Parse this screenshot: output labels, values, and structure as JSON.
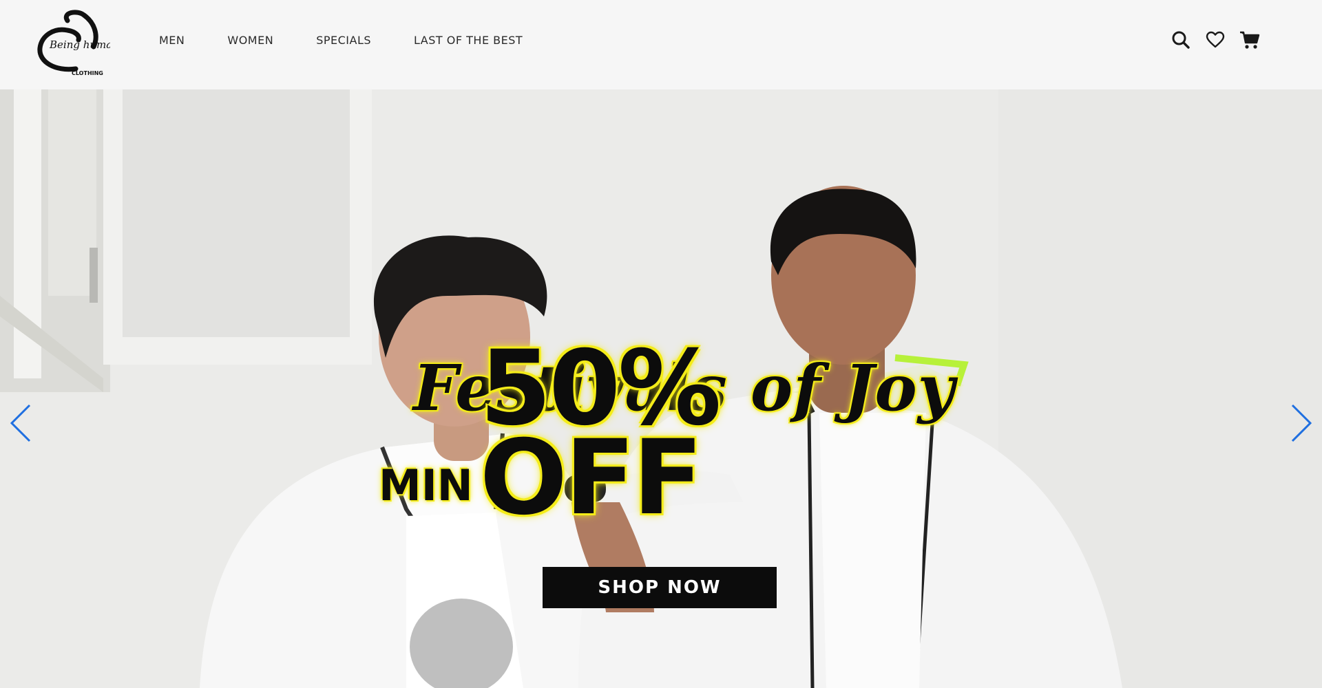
{
  "brand": {
    "name": "Being human",
    "sub": "CLOTHING"
  },
  "nav": {
    "items": [
      {
        "label": "MEN"
      },
      {
        "label": "WOMEN"
      },
      {
        "label": "SPECIALS"
      },
      {
        "label": "LAST OF THE BEST"
      }
    ]
  },
  "header_icons": [
    "search-icon",
    "heart-icon",
    "cart-icon"
  ],
  "hero": {
    "title": "Festivals of Joy",
    "offer_prefix": "MIN",
    "offer_main": "50% OFF",
    "cta": "SHOP NOW",
    "arrows": [
      "chevron-left-icon",
      "chevron-right-icon"
    ]
  },
  "colors": {
    "header_bg": "#f6f6f6",
    "highlight": "#f4ec1a",
    "arrow": "#1f6fe0",
    "cta_bg": "#0c0c0c"
  }
}
